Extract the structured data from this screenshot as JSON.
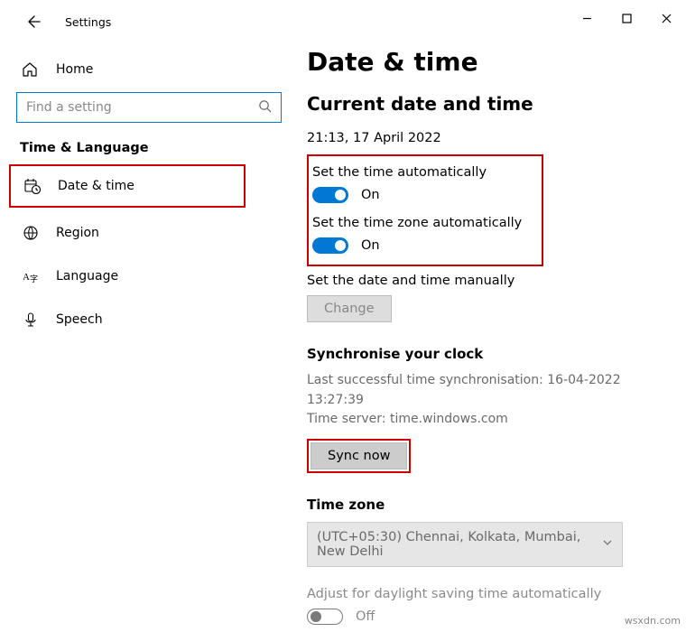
{
  "titlebar": {
    "title": "Settings"
  },
  "home": {
    "label": "Home"
  },
  "search": {
    "placeholder": "Find a setting"
  },
  "category": "Time & Language",
  "nav": {
    "date_time": "Date & time",
    "region": "Region",
    "language": "Language",
    "speech": "Speech"
  },
  "main": {
    "heading": "Date & time",
    "subheading": "Current date and time",
    "datetime": "21:13, 17 April 2022",
    "auto_time": {
      "label": "Set the time automatically",
      "state": "On"
    },
    "auto_zone": {
      "label": "Set the time zone automatically",
      "state": "On"
    },
    "manual": {
      "label": "Set the date and time manually",
      "button": "Change"
    },
    "sync": {
      "heading": "Synchronise your clock",
      "last": "Last successful time synchronisation: 16-04-2022 13:27:39",
      "server": "Time server: time.windows.com",
      "button": "Sync now"
    },
    "timezone": {
      "heading": "Time zone",
      "value": "(UTC+05:30) Chennai, Kolkata, Mumbai, New Delhi"
    },
    "dst": {
      "label": "Adjust for daylight saving time automatically",
      "state": "Off"
    }
  },
  "watermark": "wsxdn.com"
}
